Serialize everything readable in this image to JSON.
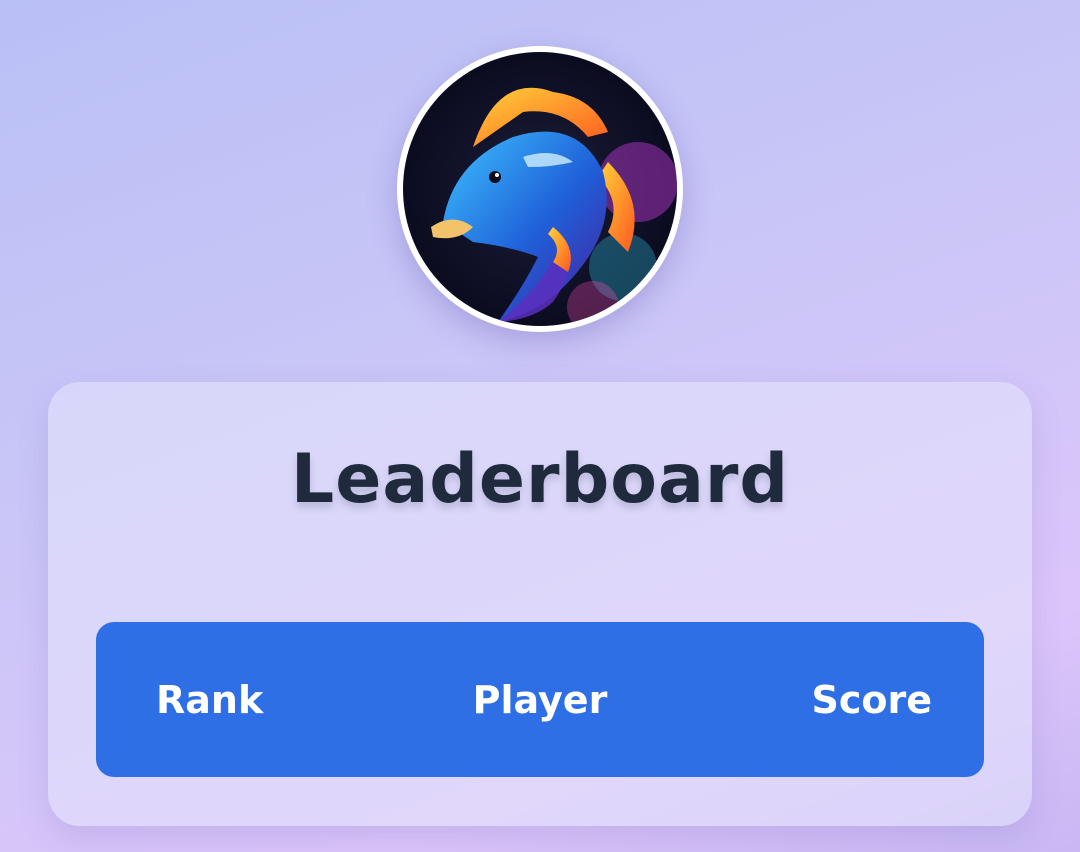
{
  "avatar": {
    "icon": "fish-avatar-icon",
    "colors": {
      "background": "#0c0d24",
      "body": "#1f9be8",
      "fin": "#ff8a2b",
      "accent": "#c23ad6"
    }
  },
  "leaderboard": {
    "title": "Leaderboard",
    "columns": [
      "Rank",
      "Player",
      "Score"
    ],
    "header_color": "#2f6fe6"
  }
}
